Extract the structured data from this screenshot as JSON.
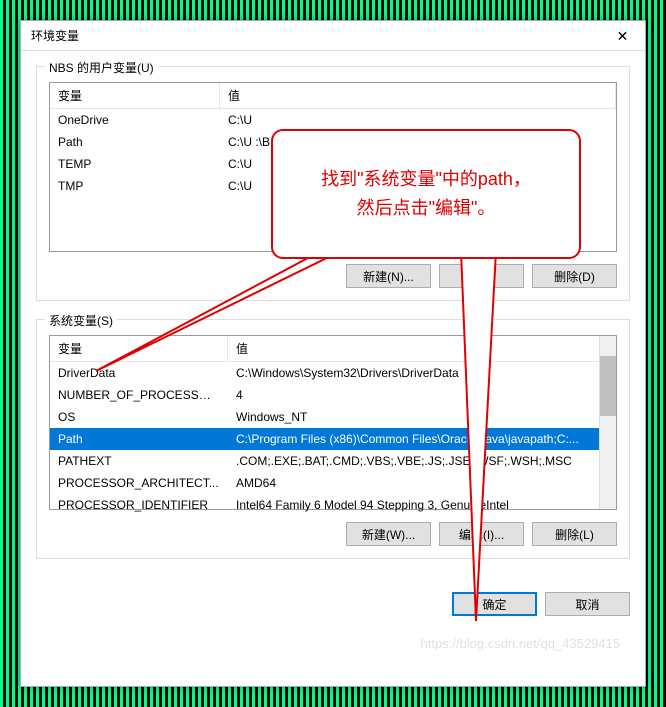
{
  "dialog": {
    "title": "环境变量",
    "close": "✕"
  },
  "user_vars": {
    "group_label": "NBS 的用户变量(U)",
    "header_name": "变量",
    "header_value": "值",
    "rows": [
      {
        "name": "OneDrive",
        "value": "C:\\U"
      },
      {
        "name": "Path",
        "value": "C:\\U                                                                                           :\\B..."
      },
      {
        "name": "TEMP",
        "value": "C:\\U"
      },
      {
        "name": "TMP",
        "value": "C:\\U"
      }
    ],
    "btn_new": "新建(N)...",
    "btn_edit": "编",
    "btn_delete": "删除(D)"
  },
  "sys_vars": {
    "group_label": "系统变量(S)",
    "header_name": "变量",
    "header_value": "值",
    "rows": [
      {
        "name": "DriverData",
        "value": "C:\\Windows\\System32\\Drivers\\DriverData"
      },
      {
        "name": "NUMBER_OF_PROCESSORS",
        "value": "4"
      },
      {
        "name": "OS",
        "value": "Windows_NT"
      },
      {
        "name": "Path",
        "value": "C:\\Program Files (x86)\\Common Files\\Oracle\\Java\\javapath;C:...",
        "selected": true
      },
      {
        "name": "PATHEXT",
        "value": ".COM;.EXE;.BAT;.CMD;.VBS;.VBE;.JS;.JSE;.WSF;.WSH;.MSC"
      },
      {
        "name": "PROCESSOR_ARCHITECT...",
        "value": "AMD64"
      },
      {
        "name": "PROCESSOR_IDENTIFIER",
        "value": "Intel64 Family 6 Model 94 Stepping 3, GenuineIntel"
      }
    ],
    "btn_new": "新建(W)...",
    "btn_edit": "编辑(I)...",
    "btn_delete": "删除(L)"
  },
  "dialog_buttons": {
    "ok": "确定",
    "cancel": "取消"
  },
  "callout": {
    "line1": "找到\"系统变量\"中的path，",
    "line2": "然后点击\"编辑\"。"
  },
  "watermark": "https://blog.csdn.net/qq_43529415"
}
